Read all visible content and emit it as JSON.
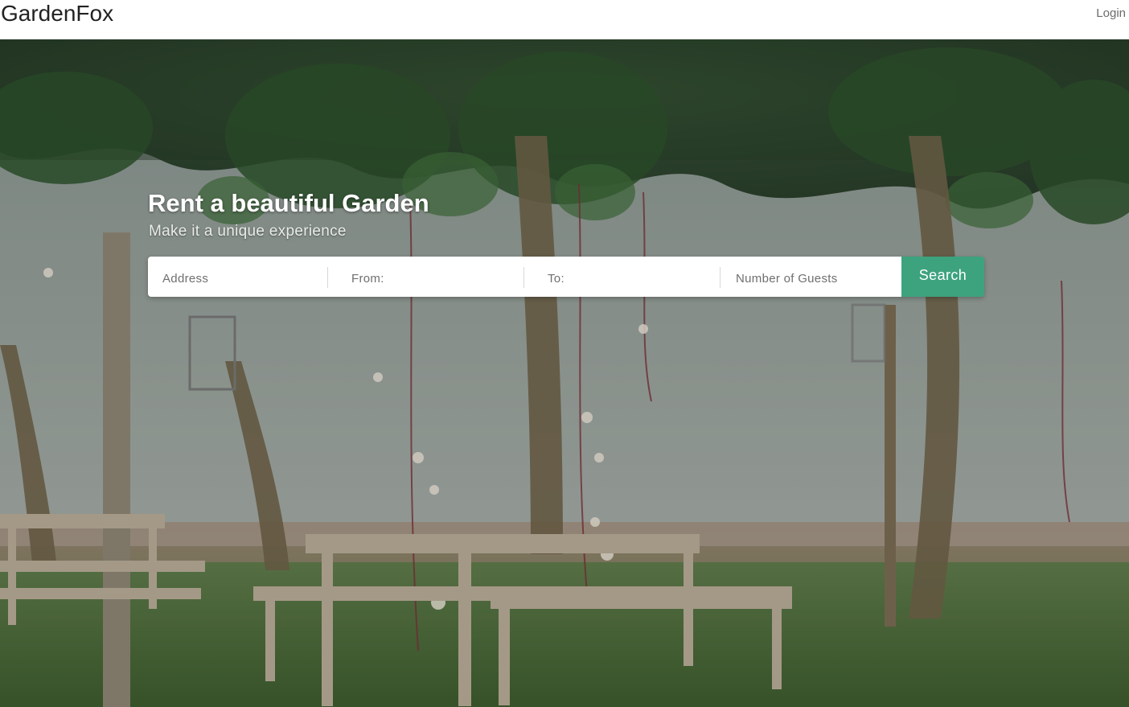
{
  "nav": {
    "brand": "GardenFox",
    "login_label": "Login"
  },
  "hero": {
    "title": "Rent a beautiful Garden",
    "subtitle": "Make it a unique experience",
    "background_image": "garden-benches-photo"
  },
  "search": {
    "address_placeholder": "Address",
    "from_placeholder": "From:",
    "to_placeholder": "To:",
    "guests_placeholder": "Number of Guests",
    "button_label": "Search",
    "button_color": "#3da37e"
  }
}
